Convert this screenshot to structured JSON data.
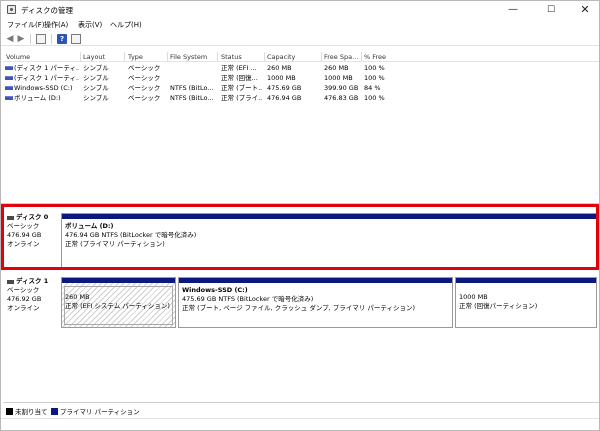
{
  "window": {
    "title": "ディスクの管理",
    "controls": {
      "minimize": "—",
      "maximize": "☐",
      "close": "✕"
    }
  },
  "menu": [
    "ファイル(F)",
    "操作(A)",
    "表示(V)",
    "ヘルプ(H)"
  ],
  "toolbar": {
    "buttons": [
      "back-icon",
      "forward-icon",
      "console-tree-icon",
      "help-icon",
      "properties-icon"
    ],
    "help_glyph": "?"
  },
  "volume_list": {
    "columns": [
      "Volume",
      "Layout",
      "Type",
      "File System",
      "Status",
      "Capacity",
      "Free Spa...",
      "% Free"
    ],
    "rows": [
      [
        "(ディスク 1 パーティ...",
        "シンプル",
        "ベーシック",
        "",
        "正常 (EFI ...",
        "260 MB",
        "260 MB",
        "100 %"
      ],
      [
        "(ディスク 1 パーティ...",
        "シンプル",
        "ベーシック",
        "",
        "正常 (回復...",
        "1000 MB",
        "1000 MB",
        "100 %"
      ],
      [
        "Windows-SSD (C:)",
        "シンプル",
        "ベーシック",
        "NTFS (BitLo...",
        "正常 (ブート...",
        "475.69 GB",
        "399.90 GB",
        "84 %"
      ],
      [
        "ボリューム (D:)",
        "シンプル",
        "ベーシック",
        "NTFS (BitLo...",
        "正常 (プライ...",
        "476.94 GB",
        "476.83 GB",
        "100 %"
      ]
    ]
  },
  "disks": {
    "disk0": {
      "name": "ディスク 0",
      "type": "ベーシック",
      "size": "476.94 GB",
      "status": "オンライン",
      "partition": {
        "title": "ボリューム (D:)",
        "detail": "476.94 GB NTFS (BitLocker で暗号化済み)",
        "status": "正常 (プライマリ パーティション)"
      }
    },
    "disk1": {
      "name": "ディスク 1",
      "type": "ベーシック",
      "size": "476.92 GB",
      "status": "オンライン",
      "efi": {
        "size": "260 MB",
        "status": "正常 (EFI システム パーティション)"
      },
      "windows": {
        "title": "Windows-SSD (C:)",
        "detail": "475.69 GB NTFS (BitLocker で暗号化済み)",
        "status": "正常 (ブート, ページ ファイル, クラッシュ ダンプ, プライマリ パーティション)"
      },
      "recovery": {
        "size": "1000 MB",
        "status": "正常 (回復パーティション)"
      }
    }
  },
  "legend": {
    "unallocated": {
      "label": "未割り当て",
      "color": "#000000"
    },
    "primary": {
      "label": "プライマリ パーティション",
      "color": "#0b1882"
    }
  },
  "highlight_color": "#e3000b"
}
